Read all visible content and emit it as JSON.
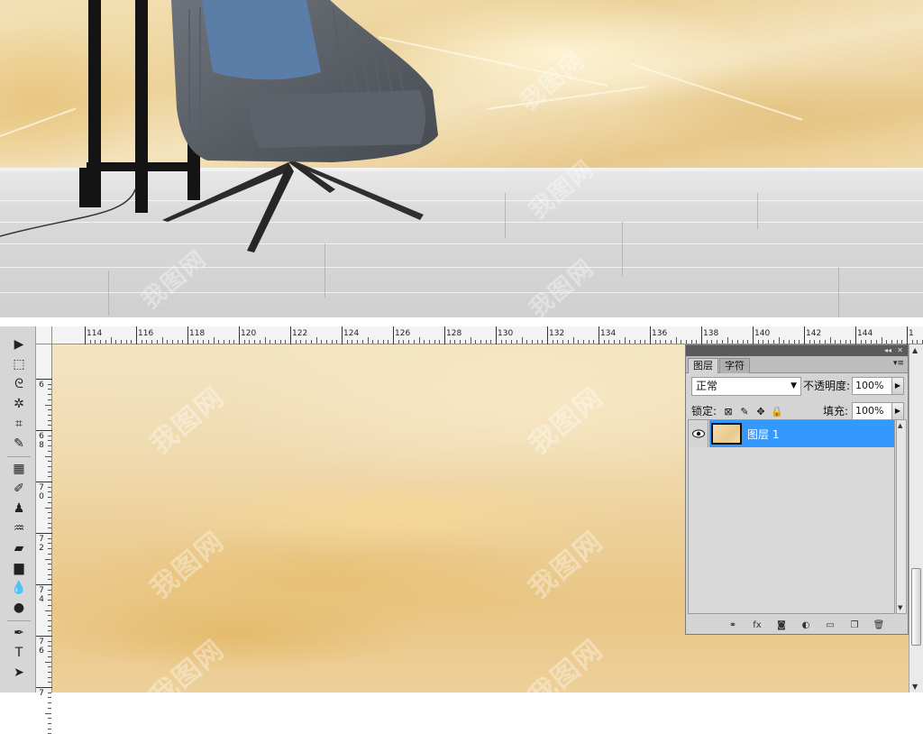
{
  "watermark_text": "我图网",
  "ruler": {
    "top_labels": [
      "114",
      "116",
      "118",
      "120",
      "122",
      "124",
      "126",
      "128",
      "130",
      "132",
      "134",
      "136",
      "138",
      "140",
      "142",
      "144",
      "1"
    ],
    "left_labels": [
      [
        "6"
      ],
      [
        "6",
        "8"
      ],
      [
        "7",
        "0"
      ],
      [
        "7",
        "2"
      ],
      [
        "7",
        "4"
      ],
      [
        "7",
        "6"
      ],
      [
        "7"
      ]
    ]
  },
  "toolbar": {
    "tools": [
      {
        "name": "move-tool-icon",
        "glyph": "▶"
      },
      {
        "name": "marquee-tool-icon",
        "glyph": "⬚"
      },
      {
        "name": "lasso-tool-icon",
        "glyph": "ᘓ"
      },
      {
        "name": "magic-wand-tool-icon",
        "glyph": "✲"
      },
      {
        "name": "crop-tool-icon",
        "glyph": "⌗"
      },
      {
        "name": "eyedropper-tool-icon",
        "glyph": "✎"
      },
      {
        "name": "healing-brush-tool-icon",
        "glyph": "▦"
      },
      {
        "name": "brush-tool-icon",
        "glyph": "✐"
      },
      {
        "name": "clone-stamp-tool-icon",
        "glyph": "♟"
      },
      {
        "name": "history-brush-tool-icon",
        "glyph": "♒"
      },
      {
        "name": "eraser-tool-icon",
        "glyph": "▰"
      },
      {
        "name": "gradient-tool-icon",
        "glyph": "▆"
      },
      {
        "name": "blur-tool-icon",
        "glyph": "💧"
      },
      {
        "name": "dodge-tool-icon",
        "glyph": "●"
      },
      {
        "name": "pen-tool-icon",
        "glyph": "✒"
      },
      {
        "name": "type-tool-icon",
        "glyph": "T"
      },
      {
        "name": "path-selection-tool-icon",
        "glyph": "➤"
      }
    ]
  },
  "layers_panel": {
    "tabs": [
      {
        "label": "图层",
        "active": true
      },
      {
        "label": "字符",
        "active": false
      }
    ],
    "blend_mode": "正常",
    "opacity_label": "不透明度:",
    "opacity_value": "100%",
    "lock_label": "锁定:",
    "fill_label": "填充:",
    "fill_value": "100%",
    "layers": [
      {
        "name": "图层 1",
        "visible": true,
        "selected": true
      }
    ],
    "footer_buttons": [
      {
        "name": "link-layers-icon",
        "glyph": "⚭"
      },
      {
        "name": "layer-style-icon",
        "glyph": "fx"
      },
      {
        "name": "layer-mask-icon",
        "glyph": "◙"
      },
      {
        "name": "adjustment-layer-icon",
        "glyph": "◐"
      },
      {
        "name": "new-group-icon",
        "glyph": "▭"
      },
      {
        "name": "new-layer-icon",
        "glyph": "❐"
      },
      {
        "name": "delete-layer-icon",
        "glyph": "🗑"
      }
    ]
  },
  "colors": {
    "selection_blue": "#3399ff",
    "panel_gray": "#d4d4d4",
    "marble_gold": "#ecd29a"
  }
}
